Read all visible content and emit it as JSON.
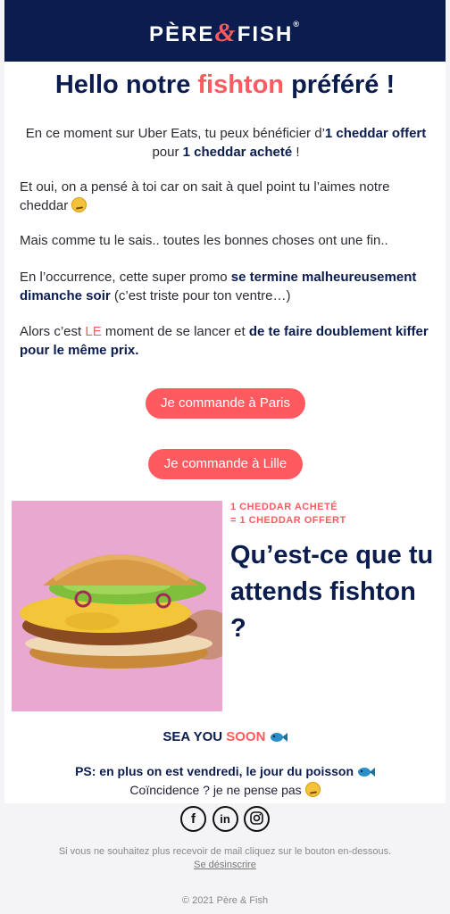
{
  "header": {
    "logo_left": "PÈRE",
    "logo_amp": "&",
    "logo_right": "FISH",
    "logo_reg": "®"
  },
  "title": {
    "prefix": "Hello notre ",
    "accent": "fishton",
    "suffix": " préféré !"
  },
  "intro": {
    "t1": "En ce moment sur Uber Eats, tu peux bénéficier d’",
    "b1": "1 cheddar offert",
    "t2": " pour ",
    "b2": "1 cheddar acheté",
    "t3": " !"
  },
  "para2": "Et oui, on a pensé à toi car on sait à quel point tu l’aimes notre cheddar",
  "para3": "Mais comme tu le sais.. toutes les bonnes choses ont une fin..",
  "para4": {
    "t1": "En l’occurrence, cette super promo ",
    "b1": "se termine malheureusement dimanche soir",
    "t2": " (c’est triste pour ton ventre…)"
  },
  "para5": {
    "t1": "Alors c’est ",
    "red": "LE",
    "t2": " moment de se lancer et ",
    "b1": "de te faire doublement kiffer pour le même prix."
  },
  "buttons": {
    "paris": "Je commande à Paris",
    "lille": "Je commande à Lille"
  },
  "promo": {
    "line1": "1 CHEDDAR ACHETÉ",
    "line2": "= 1 CHEDDAR  OFFERT",
    "title": "Qu’est-ce que tu attends fishton ?"
  },
  "sea": {
    "prefix": "SEA YOU ",
    "accent": "SOON"
  },
  "ps": {
    "bold": "PS: en plus on est vendredi, le jour du poisson",
    "line2": "Coïncidence ? je ne pense pas"
  },
  "social": {
    "facebook": "f",
    "linkedin": "in"
  },
  "footer": {
    "unsubscribe_text": "Si vous ne souhaitez plus recevoir de mail cliquez sur le bouton en-dessous.",
    "unsubscribe_link": "Se désinscrire",
    "copyright": "© 2021 Père & Fish"
  },
  "colors": {
    "navy": "#0b1c4f",
    "coral": "#ff5a5f",
    "pink_bg": "#e8a8cf"
  },
  "icons": [
    "smirk-emoji-icon",
    "fish-icon",
    "facebook-icon",
    "linkedin-icon",
    "instagram-icon"
  ]
}
